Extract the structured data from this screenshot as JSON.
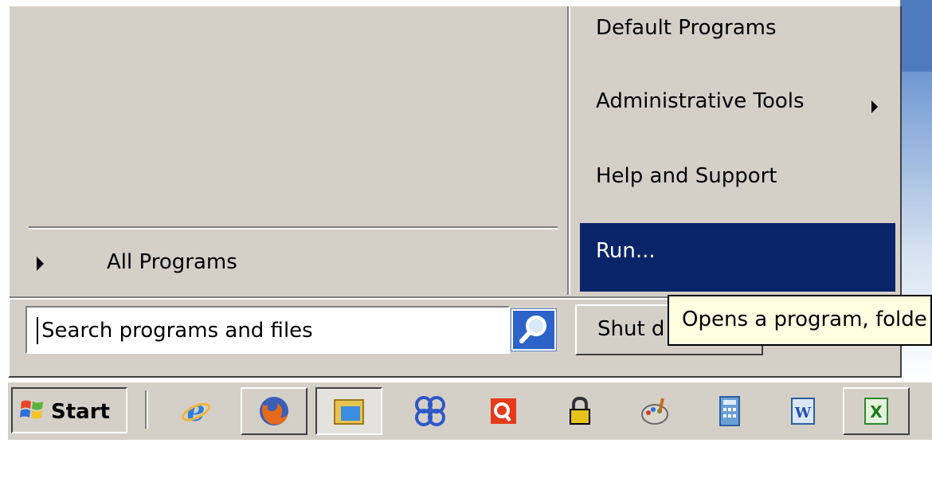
{
  "start_menu": {
    "left": {
      "all_programs_label": "All Programs"
    },
    "right": {
      "items": [
        {
          "label": "Default Programs",
          "has_submenu": false
        },
        {
          "label": "Administrative Tools",
          "has_submenu": true
        },
        {
          "label": "Help and Support",
          "has_submenu": false
        },
        {
          "label": "Run...",
          "has_submenu": false,
          "highlighted": true
        }
      ]
    },
    "search": {
      "placeholder": "Search programs and files",
      "icon": "search-icon"
    },
    "shutdown_label": "Shut d"
  },
  "tooltip": {
    "text": "Opens a program, folde"
  },
  "taskbar": {
    "start_label": "Start",
    "quick_launch": [
      {
        "name": "internet-explorer-icon"
      },
      {
        "name": "firefox-icon"
      },
      {
        "name": "file-manager-icon"
      },
      {
        "name": "blue-loops-icon"
      },
      {
        "name": "red-q-icon"
      },
      {
        "name": "lock-icon"
      },
      {
        "name": "paint-icon"
      },
      {
        "name": "calculator-icon"
      },
      {
        "name": "word-icon"
      },
      {
        "name": "excel-icon"
      }
    ]
  },
  "colors": {
    "menu_face": "#d4d0c8",
    "highlight": "#0a246a",
    "tooltip_bg": "#ffffe1",
    "desktop": "#4e7bbd"
  }
}
